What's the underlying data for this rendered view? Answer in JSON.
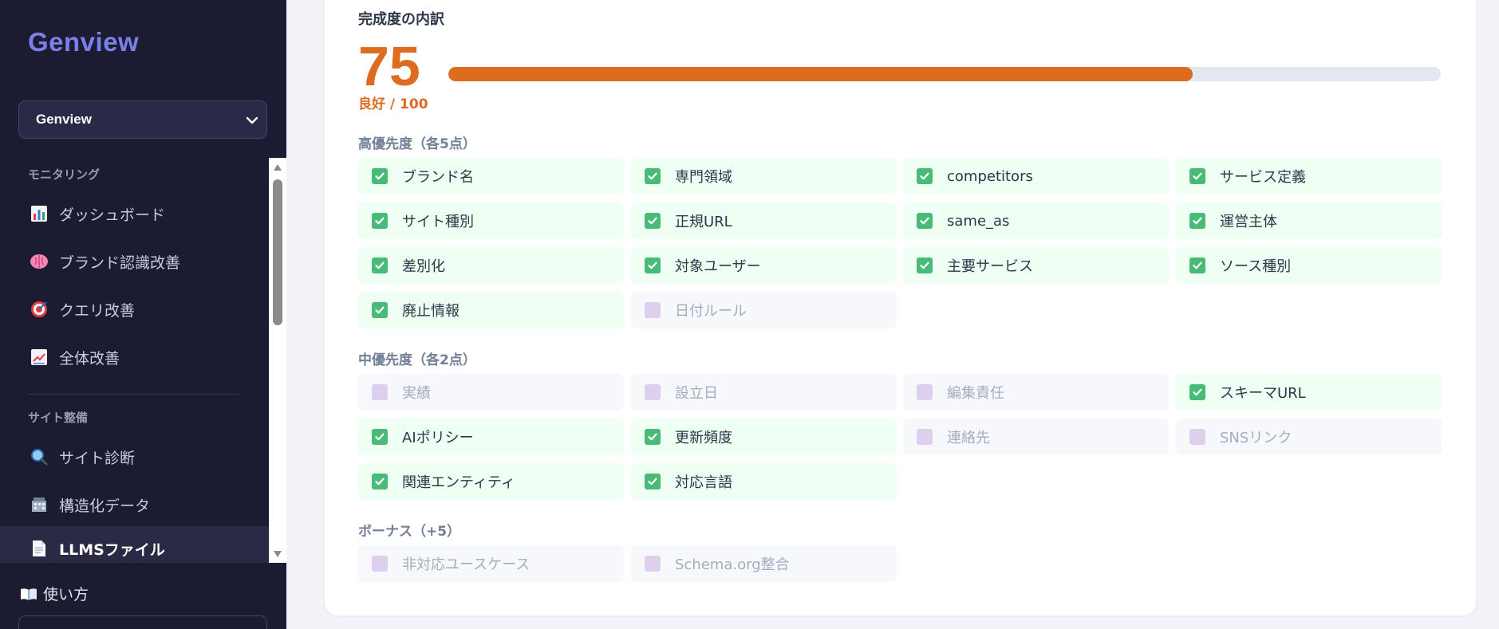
{
  "sidebar": {
    "brand": "Genview",
    "site_selector": {
      "value": "Genview"
    },
    "sections": [
      {
        "label": "モニタリング",
        "items": [
          {
            "label": "ダッシュボード",
            "icon": "bar-chart-icon"
          },
          {
            "label": "ブランド認識改善",
            "icon": "brain-icon"
          },
          {
            "label": "クエリ改善",
            "icon": "target-icon"
          },
          {
            "label": "全体改善",
            "icon": "trending-up-icon"
          }
        ]
      },
      {
        "label": "サイト整備",
        "items": [
          {
            "label": "サイト診断",
            "icon": "magnifier-icon"
          },
          {
            "label": "構造化データ",
            "icon": "building-icon"
          },
          {
            "label": "LLMSファイル",
            "icon": "document-icon",
            "active": true
          }
        ]
      }
    ],
    "footer": {
      "howto_label": "使い方",
      "icon": "book-icon"
    }
  },
  "main": {
    "title": "完成度の内訳",
    "score": {
      "value": "75",
      "sub": "良好 / 100",
      "progress_fraction": 0.75
    },
    "groups": [
      {
        "label": "高優先度（各5点）",
        "items": [
          {
            "label": "ブランド名",
            "checked": true
          },
          {
            "label": "専門領域",
            "checked": true
          },
          {
            "label": "competitors",
            "checked": true
          },
          {
            "label": "サービス定義",
            "checked": true
          },
          {
            "label": "サイト種別",
            "checked": true
          },
          {
            "label": "正規URL",
            "checked": true
          },
          {
            "label": "same_as",
            "checked": true
          },
          {
            "label": "運営主体",
            "checked": true
          },
          {
            "label": "差別化",
            "checked": true
          },
          {
            "label": "対象ユーザー",
            "checked": true
          },
          {
            "label": "主要サービス",
            "checked": true
          },
          {
            "label": "ソース種別",
            "checked": true
          },
          {
            "label": "廃止情報",
            "checked": true
          },
          {
            "label": "日付ルール",
            "checked": false
          }
        ]
      },
      {
        "label": "中優先度（各2点）",
        "items": [
          {
            "label": "実績",
            "checked": false
          },
          {
            "label": "設立日",
            "checked": false
          },
          {
            "label": "編集責任",
            "checked": false
          },
          {
            "label": "スキーマURL",
            "checked": true
          },
          {
            "label": "AIポリシー",
            "checked": true
          },
          {
            "label": "更新頻度",
            "checked": true
          },
          {
            "label": "連絡先",
            "checked": false
          },
          {
            "label": "SNSリンク",
            "checked": false
          },
          {
            "label": "関連エンティティ",
            "checked": true
          },
          {
            "label": "対応言語",
            "checked": true
          }
        ]
      },
      {
        "label": "ボーナス（+5）",
        "items": [
          {
            "label": "非対応ユースケース",
            "checked": false
          },
          {
            "label": "Schema.org整合",
            "checked": false
          }
        ]
      }
    ]
  },
  "colors": {
    "sidebar_bg": "#1b1b31",
    "brand": "#7b7fe8",
    "accent_orange": "#dd6b20",
    "check_green": "#48bb78",
    "check_off": "#ddd0ef"
  }
}
